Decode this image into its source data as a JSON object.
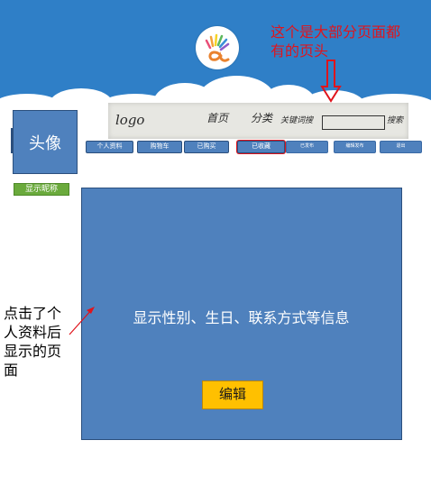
{
  "header": {
    "background_color": "#2f7fc7",
    "logo_icon": "colorful-a-logo-icon"
  },
  "annotation_top": {
    "line1": "这个是大部分页面都",
    "line2": "有的页头",
    "color": "#e0141c"
  },
  "sketch": {
    "logo": "logo",
    "category1": "首页",
    "category2": "分类",
    "search_hint": "关键词搜",
    "search_button": "搜索"
  },
  "avatar": {
    "label": "头像"
  },
  "nickname": {
    "label": "显示昵称"
  },
  "nav": {
    "profile": "个人资料",
    "cart": "购物车",
    "bought": "已购买",
    "favorites": "已收藏",
    "published": "已发布",
    "edit_publish": "编辑发布",
    "logout": "退出"
  },
  "main": {
    "info": "显示性别、生日、联系方式等信息",
    "edit_button": "编辑",
    "panel_color": "#4f81bd",
    "edit_color": "#ffc000"
  },
  "left_note": {
    "line1": "点击了个",
    "line2": "人资料后",
    "line3": "显示的页",
    "line4": "面"
  }
}
